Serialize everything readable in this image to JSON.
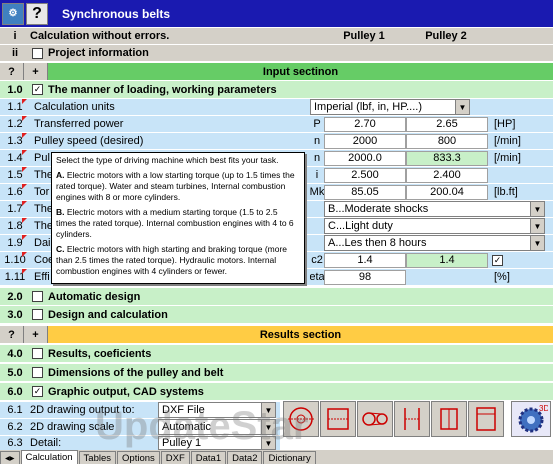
{
  "titlebar": {
    "title": "Synchronous belts"
  },
  "status": {
    "index": "i",
    "text": "Calculation without errors.",
    "col1": "Pulley 1",
    "col2": "Pulley 2"
  },
  "project": {
    "index": "ii",
    "label": "Project information"
  },
  "input_section": {
    "q": "?",
    "plus": "+",
    "label": "Input sectinon"
  },
  "sec1": {
    "num": "1.0",
    "label": "The manner of loading, working parameters"
  },
  "rows": [
    {
      "num": "1.1",
      "label": "Calculation units",
      "sym": "",
      "unit": ""
    },
    {
      "num": "1.2",
      "label": "Transferred power",
      "sym": "P",
      "v1": "2.70",
      "v2": "2.65",
      "unit": "[HP]"
    },
    {
      "num": "1.3",
      "label": "Pulley speed (desired)",
      "sym": "n",
      "v1": "2000",
      "v2": "800",
      "unit": "[/min]"
    },
    {
      "num": "1.4",
      "label": "Pul",
      "sym": "n",
      "v1": "2000.0",
      "v2": "833.3",
      "unit": "[/min]"
    },
    {
      "num": "1.5",
      "label": "The",
      "sym": "i",
      "v1": "2.500",
      "v2": "2.400",
      "unit": ""
    },
    {
      "num": "1.6",
      "label": "Tor",
      "sym": "Mk",
      "v1": "85.05",
      "v2": "200.04",
      "unit": "[lb.ft]"
    },
    {
      "num": "1.7",
      "label": "The",
      "sym": "",
      "unit": ""
    },
    {
      "num": "1.8",
      "label": "The",
      "sym": "",
      "unit": ""
    },
    {
      "num": "1.9",
      "label": "Dail",
      "sym": "",
      "unit": ""
    },
    {
      "num": "1.10",
      "label": "Coe",
      "sym": "c2",
      "v1": "1.4",
      "v2": "1.4",
      "unit": ""
    },
    {
      "num": "1.11",
      "label": "Effi",
      "sym": "eta",
      "v1": "98",
      "unit": "[%]"
    }
  ],
  "units_select": "Imperial (lbf, in, HP....)",
  "select_17": "B...Moderate shocks",
  "select_18": "C...Light duty",
  "select_19": "A...Les then 8 hours",
  "tooltip": {
    "intro": "Select the type of driving machine which best fits your task.",
    "a_key": "A.",
    "a_text": "Electric motors with a low starting torque (up to 1.5 times the rated torque). Water and steam turbines, Internal combustion engines with 8 or more cylinders.",
    "b_key": "B.",
    "b_text": "Electric motors with a medium starting torque (1.5 to 2.5 times the rated torque). Internal combustion engines with 4 to 6 cylinders.",
    "c_key": "C.",
    "c_text": "Electric motors with high starting and braking torque (more than 2.5 times the rated torque). Hydraulic motors. Internal combustion engines with 4 cylinders or fewer."
  },
  "sec2": {
    "num": "2.0",
    "label": "Automatic design"
  },
  "sec3": {
    "num": "3.0",
    "label": "Design and calculation"
  },
  "results_section": {
    "q": "?",
    "plus": "+",
    "label": "Results section"
  },
  "sec4": {
    "num": "4.0",
    "label": "Results, coeficients"
  },
  "sec5": {
    "num": "5.0",
    "label": "Dimensions of the pulley and belt"
  },
  "sec6": {
    "num": "6.0",
    "label": "Graphic output, CAD systems"
  },
  "r61": {
    "num": "6.1",
    "label": "2D drawing output to:",
    "value": "DXF File"
  },
  "r62": {
    "num": "6.2",
    "label": "2D drawing scale",
    "value": "Automatic"
  },
  "r63": {
    "num": "6.3",
    "label": "Detail:",
    "value": "Pulley 1"
  },
  "tabs": [
    "Calculation",
    "Tables",
    "Options",
    "DXF",
    "Data1",
    "Data2",
    "Dictionary"
  ],
  "watermark": "UpdateStar"
}
